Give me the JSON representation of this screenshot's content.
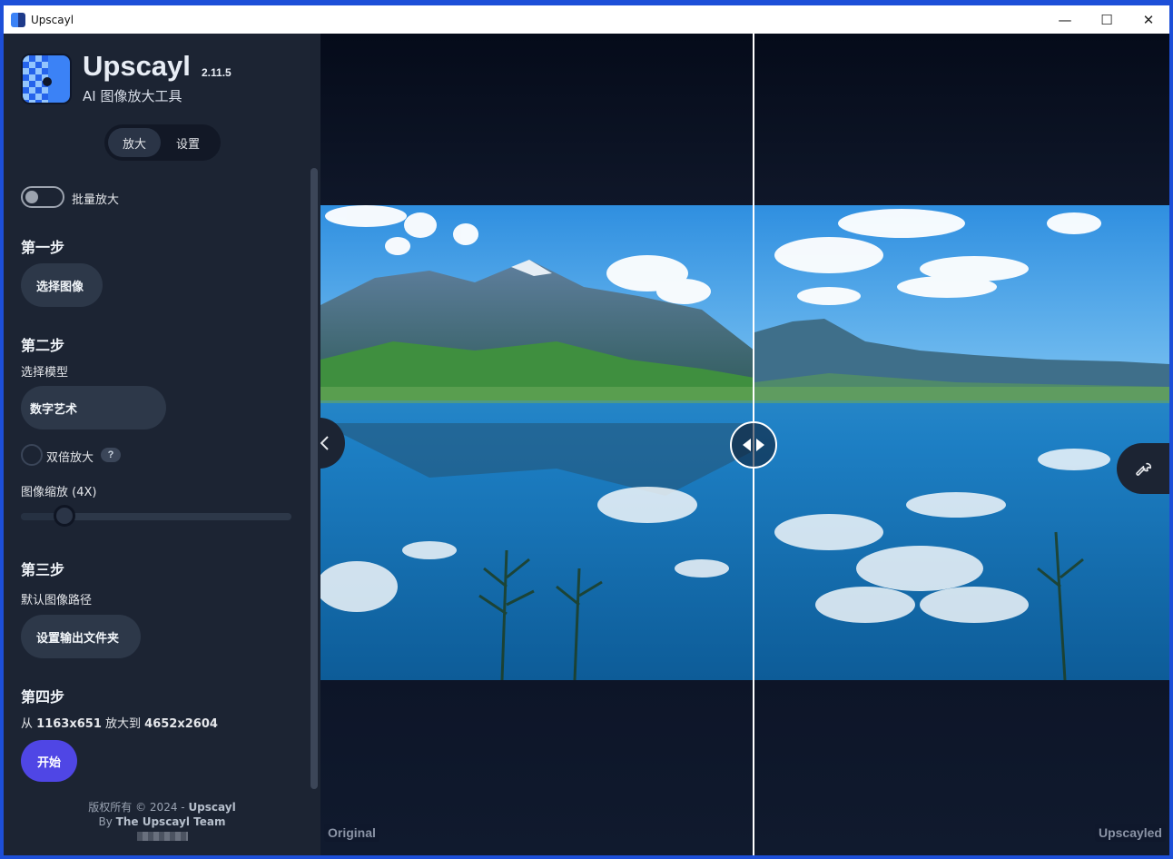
{
  "window": {
    "title": "Upscayl",
    "minimize_glyph": "—",
    "maximize_glyph": "☐",
    "close_glyph": "✕"
  },
  "app": {
    "name": "Upscayl",
    "version": "2.11.5",
    "subtitle": "AI 图像放大工具"
  },
  "tabs": [
    {
      "label": "放大",
      "active": true
    },
    {
      "label": "设置",
      "active": false
    }
  ],
  "batch": {
    "label": "批量放大",
    "enabled": false
  },
  "step1": {
    "title": "第一步",
    "button": "选择图像"
  },
  "step2": {
    "title": "第二步",
    "model_label": "选择模型",
    "model_value": "数字艺术",
    "double_upscale_label": "双倍放大",
    "double_upscale_checked": false,
    "help_glyph": "?",
    "scale_label": "图像缩放 (4X)",
    "scale_level": 0.12
  },
  "step3": {
    "title": "第三步",
    "path_label": "默认图像路径",
    "button": "设置输出文件夹"
  },
  "step4": {
    "title": "第四步",
    "from_word": "从",
    "from_size": "1163x651",
    "to_word": "放大到",
    "to_size": "4652x2604",
    "start_button": "开始"
  },
  "footer": {
    "copyright": "版权所有 © 2024 - ",
    "brand": "Upscayl",
    "by": "By ",
    "team": "The Upscayl Team"
  },
  "viewer": {
    "left_label": "Original",
    "right_label": "Upscayled",
    "split_position": 0.51
  },
  "icons": {
    "collapse": "chevron-left-icon",
    "compare": "compare-arrows-icon",
    "tools": "wrench-icon"
  },
  "colors": {
    "accent": "#4f46e5",
    "sidebar": "#1c2433",
    "panel": "#2d3849"
  }
}
